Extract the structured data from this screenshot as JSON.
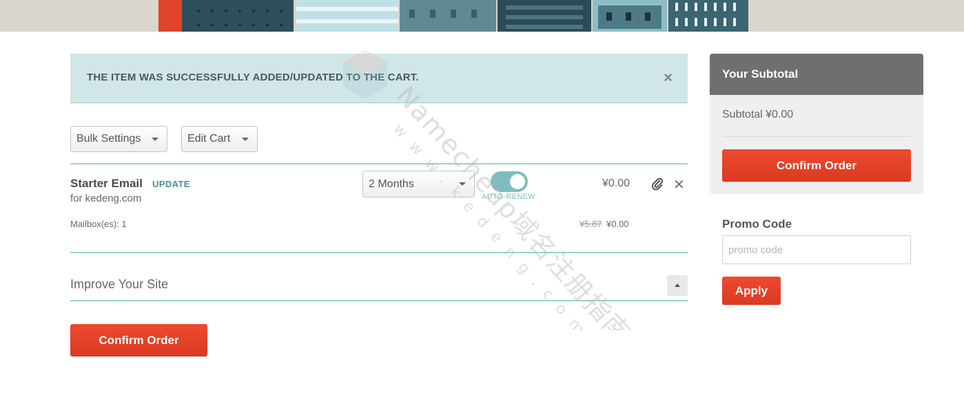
{
  "alert": {
    "message": "THE ITEM WAS SUCCESSFULLY ADDED/UPDATED TO THE CART.",
    "close_symbol": "×"
  },
  "toolbar": {
    "bulk_settings_label": "Bulk Settings",
    "edit_cart_label": "Edit Cart"
  },
  "cart_item": {
    "name": "Starter Email",
    "update_label": "UPDATE",
    "domain": "for kedeng.com",
    "term": "2 Months",
    "auto_renew_label": "AUTO-RENEW",
    "auto_renew_on": true,
    "price": "¥0.00",
    "mailbox": "Mailbox(es): 1",
    "old_price": "¥5.87",
    "new_price": "¥0.00",
    "remove_symbol": "✕"
  },
  "improve": {
    "label": "Improve Your Site"
  },
  "main_confirm_label": "Confirm Order",
  "sidebar": {
    "title": "Your Subtotal",
    "subtotal": "Subtotal ¥0.00",
    "confirm_label": "Confirm Order",
    "promo_label": "Promo Code",
    "promo_placeholder": "promo code",
    "apply_label": "Apply"
  },
  "watermark": {
    "brand": "Namecheap域名注册指南",
    "site": "www.kedeng.com"
  },
  "colors": {
    "accent_red": "#e8432b",
    "teal": "#7fbcbf",
    "alert_bg": "#d1e6e6",
    "sidebar_header": "#6f6f6f"
  }
}
